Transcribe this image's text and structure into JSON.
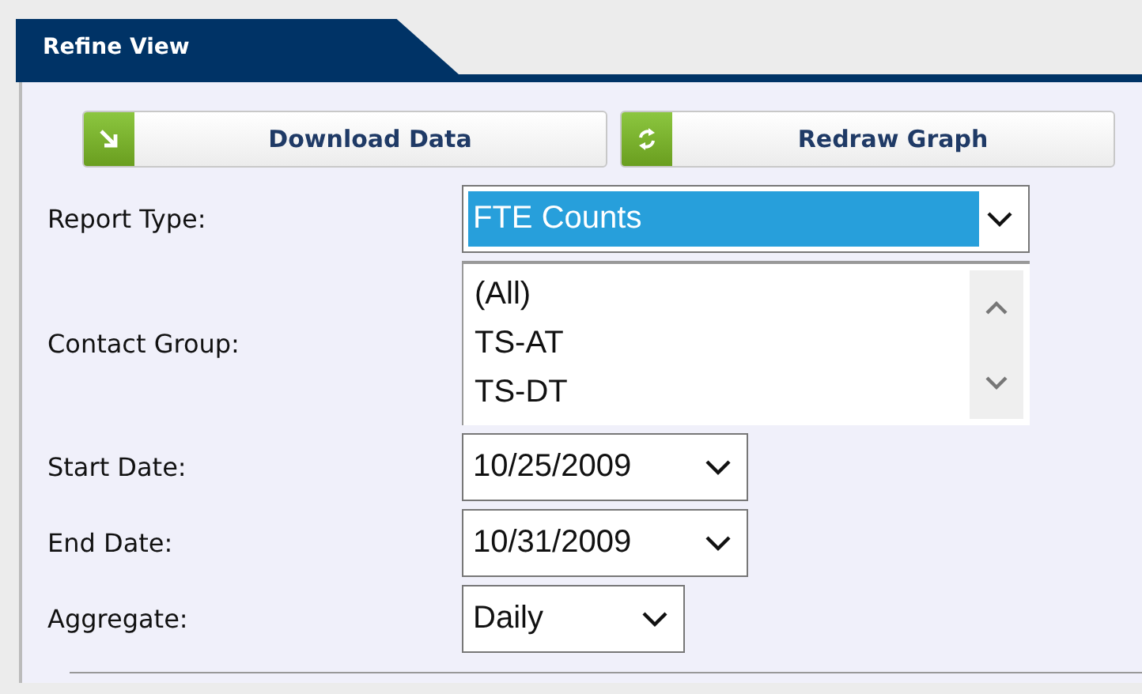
{
  "tab": {
    "title": "Refine View"
  },
  "buttons": [
    {
      "label": "Download Data"
    },
    {
      "label": "Redraw Graph"
    }
  ],
  "fields": [
    {
      "kind": "select",
      "label": "Report Type:",
      "value": "FTE Counts",
      "focused": true
    },
    {
      "kind": "listbox",
      "label": "Contact Group:",
      "options": [
        "(All)",
        "TS-AT",
        "TS-DT"
      ]
    },
    {
      "kind": "select",
      "label": "Start Date:",
      "value": "10/25/2009",
      "focused": false
    },
    {
      "kind": "select",
      "label": "End Date:",
      "value": "10/31/2009",
      "focused": false
    },
    {
      "kind": "select",
      "label": "Aggregate:",
      "value": "Daily",
      "focused": false
    }
  ]
}
